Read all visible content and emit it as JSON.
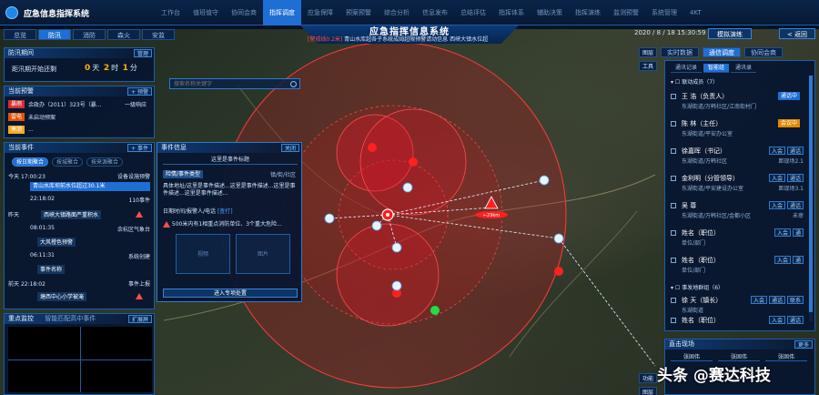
{
  "app": {
    "title": "应急信息指挥系统"
  },
  "topnav": [
    {
      "label": "工作台",
      "active": false
    },
    {
      "label": "值班值守",
      "active": false
    },
    {
      "label": "协同会商",
      "active": false
    },
    {
      "label": "指挥调度",
      "active": true
    },
    {
      "label": "应急保障",
      "active": false
    },
    {
      "label": "预案预警",
      "active": false
    },
    {
      "label": "综合分析",
      "active": false
    },
    {
      "label": "信息发布",
      "active": false
    },
    {
      "label": "总结评估",
      "active": false
    },
    {
      "label": "指挥体系",
      "active": false
    },
    {
      "label": "辅助决策",
      "active": false
    },
    {
      "label": "指挥演练",
      "active": false
    },
    {
      "label": "监测预警",
      "active": false
    },
    {
      "label": "系统管理",
      "active": false
    },
    {
      "label": "4KT",
      "active": false
    }
  ],
  "banner": {
    "title": "应急指挥信息系统",
    "ticker_alert": "[警戒线0.2米]",
    "ticker_text": "青山水库超各子系统成阈超限预警请动信息",
    "ticker_extra": "西峡大镇水位超"
  },
  "cat_tabs": [
    {
      "label": "总览",
      "active": false
    },
    {
      "label": "防汛",
      "active": true
    },
    {
      "label": "消防",
      "active": false
    },
    {
      "label": "森火",
      "active": false
    },
    {
      "label": "安监",
      "active": false
    }
  ],
  "flood": {
    "head": "防汛期间",
    "manage_btn": "管理",
    "label": "距汛期开始还剩",
    "days": "0",
    "day_unit": "天",
    "hours": "2",
    "hour_unit": "时",
    "minutes": "1",
    "minute_unit": "分"
  },
  "warning": {
    "head": "当前预警",
    "btn": "+ 预警",
    "rows": [
      {
        "badge": "暴雨",
        "color": "#d32f2f",
        "text": "余政办（2011）323号（暴...",
        "level": "一级响应"
      },
      {
        "badge": "雷电",
        "color": "#e65100",
        "text": "未启动预案",
        "level": ""
      },
      {
        "badge": "寒潮",
        "color": "#f9a825",
        "text": "...",
        "level": ""
      }
    ]
  },
  "events": {
    "head": "当前事件",
    "btn": "+ 事件",
    "tabs": [
      {
        "label": "按日期聚合",
        "active": true
      },
      {
        "label": "按城聚合",
        "active": false
      },
      {
        "label": "按来源聚合",
        "active": false
      }
    ],
    "today_label": "今天",
    "today_time": "17:00:23",
    "today_source": "设备设施预警",
    "today_event": "青山水库坝前水位超过30.1米",
    "t2_time": "22:18:02",
    "t2_source": "110事件",
    "yesterday_label": "昨天",
    "y_event": "西峡大镇路面严重积水",
    "y_time": "08:01:35",
    "y_source": "余杭区气象台",
    "y_event2": "大风橙色预警",
    "y_time2": "06:11:31",
    "y_source2": "系统创建",
    "y_event3": "事件名称",
    "before_label": "前天",
    "b_time": "22:18:02",
    "b_source": "事件上报",
    "b_event": "塘西中心小学被淹"
  },
  "video": {
    "head": "重点监控",
    "sub": "智能匹配高中事件",
    "btn": "扩展屏"
  },
  "info": {
    "head": "事件信息",
    "close_btn": "关闭",
    "subtitle": "这里是事件标题",
    "type_label": "险情/事件类型",
    "location": "镇/街/社区",
    "description": "具体地址/这里是事件描述...这里是事件描述...这里是事件描述...这里是事件描述...",
    "meta": "日期时间/报警人/电话",
    "meta_link": "[查打]",
    "alert_text": "500米内有1相重点消防单位、3个重大危险...",
    "media1": "视频",
    "media2": "图片",
    "action_btn": "进入专项处置"
  },
  "map": {
    "search_placeholder": "搜索名称关键字",
    "marker_label": "←29km"
  },
  "right": {
    "datetime": "2020 / 8 / 18  15:30:59",
    "drill_btn": "模拟演练",
    "back_btn": "< 返回",
    "tabs": [
      {
        "label": "实时数据",
        "active": false
      },
      {
        "label": "通信调度",
        "active": true
      },
      {
        "label": "协同会商",
        "active": false
      }
    ],
    "tools": [
      "图层",
      "工具"
    ],
    "contact_tabs": [
      {
        "label": "通讯记录",
        "active": false
      },
      {
        "label": "智能组",
        "active": true
      },
      {
        "label": "通讯录",
        "active": false
      }
    ],
    "group1_head": "联动成员（7）",
    "contacts": [
      {
        "name": "王 浩（负责人）",
        "org": "东湖街道/万韩社区/江南街村门",
        "status": "通话中",
        "status_color": "blue",
        "btns": [],
        "extra": ""
      },
      {
        "name": "陈 林（主任）",
        "org": "东湖街道/平安办公室",
        "status": "会议中",
        "status_color": "orange",
        "btns": [],
        "extra": ""
      },
      {
        "name": "徐嘉晖（书记）",
        "org": "东湖街道/万韩社区",
        "status": "",
        "status_color": "",
        "btns": [
          "入会",
          "通话"
        ],
        "extra": "距现场2.1"
      },
      {
        "name": "金利明（分管领导）",
        "org": "东湖街道/平安建设办公室",
        "status": "",
        "status_color": "",
        "btns": [
          "入会",
          "通话"
        ],
        "extra": "距现场3.1"
      },
      {
        "name": "吴 尊",
        "org": "东湖街道/万韩社区/金都小区",
        "status": "",
        "status_color": "",
        "btns": [
          "入会",
          "通话"
        ],
        "extra": "未审"
      },
      {
        "name": "姓名（职位）",
        "org": "单位/部门",
        "status": "",
        "status_color": "",
        "btns": [
          "入会",
          "通"
        ],
        "extra": ""
      },
      {
        "name": "姓名（职位）",
        "org": "单位/部门",
        "status": "",
        "status_color": "",
        "btns": [
          "入会",
          "通"
        ],
        "extra": ""
      }
    ],
    "group2_head": "事发地群组（6）",
    "contacts2": [
      {
        "name": "徐 天（镇长）",
        "org": "东湖街道",
        "btns": [
          "入会",
          "通话",
          "联系"
        ]
      },
      {
        "name": "姓名（职位）",
        "org": "",
        "btns": [
          "入会",
          "通话"
        ]
      }
    ],
    "onsite_head": "直击现场",
    "onsite_btn": "更多",
    "onsite_items": [
      "张固伟",
      "张固伟",
      "张固伟"
    ]
  },
  "map_tools_br": [
    "功能",
    "图层",
    "测量"
  ],
  "watermark": "头条 @赛达科技",
  "colors": {
    "accent": "#1f6ed4",
    "alert": "#ff4d4d",
    "warn": "#ffb300",
    "panel_border": "#1d5ea8"
  }
}
